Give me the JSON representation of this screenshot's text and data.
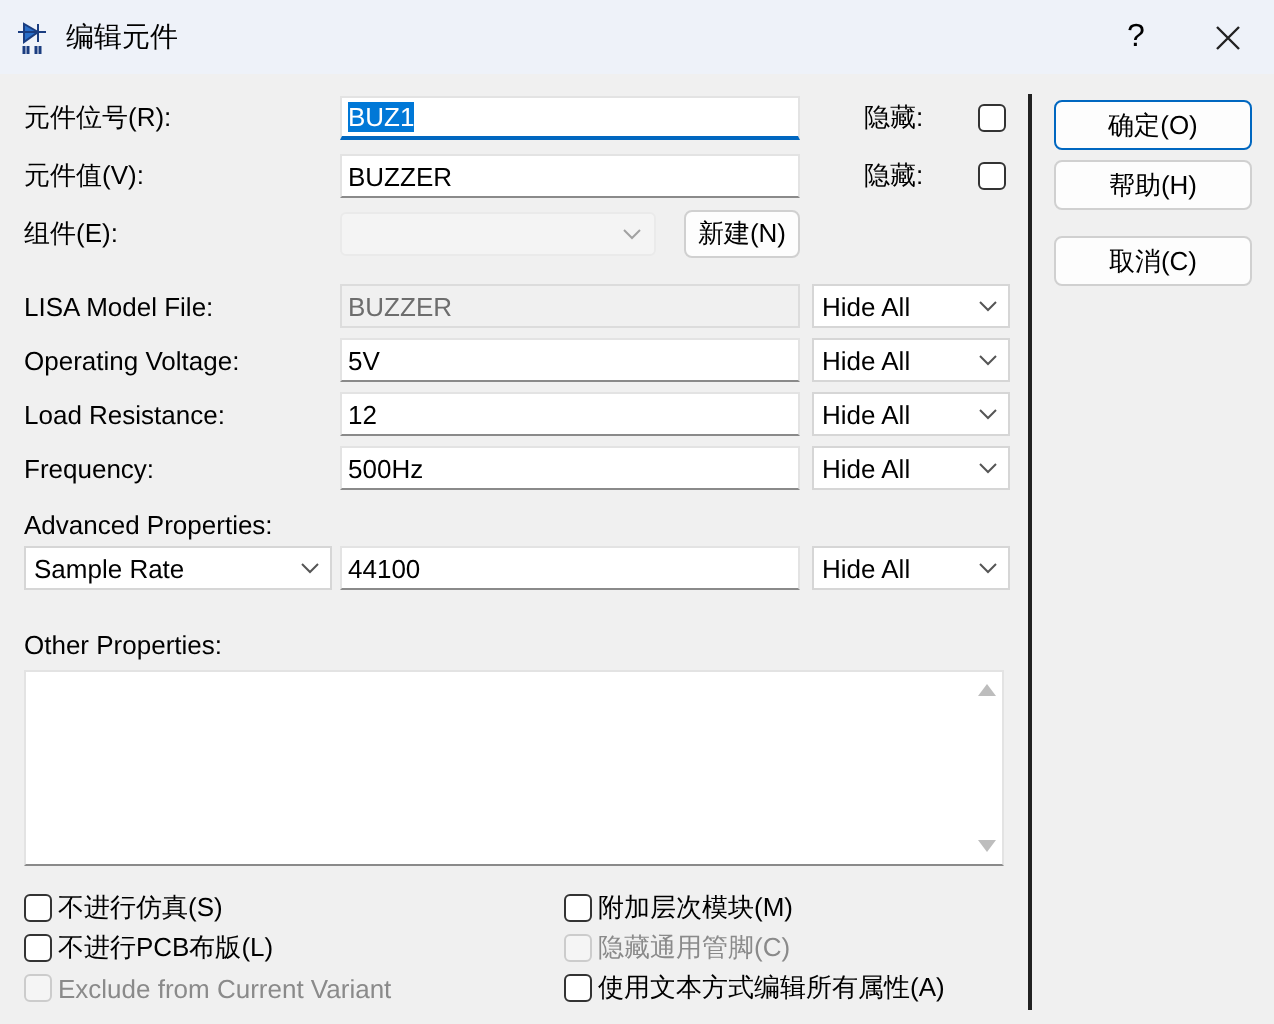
{
  "window": {
    "title": "编辑元件",
    "help": "?"
  },
  "main_fields": [
    {
      "label": "元件位号(R):",
      "value": "BUZ1",
      "selected": true,
      "hide_label": "隐藏:",
      "hidden": false
    },
    {
      "label": "元件值(V):",
      "value": "BUZZER",
      "selected": false,
      "hide_label": "隐藏:",
      "hidden": false
    }
  ],
  "component": {
    "label": "组件(E):",
    "disabled": true,
    "new_button": "新建(N)"
  },
  "properties": [
    {
      "label": "LISA Model File:",
      "value": "BUZZER",
      "disabled": true,
      "visibility": "Hide All"
    },
    {
      "label": "Operating Voltage:",
      "value": "5V",
      "disabled": false,
      "visibility": "Hide All"
    },
    {
      "label": "Load Resistance:",
      "value": "12",
      "disabled": false,
      "visibility": "Hide All"
    },
    {
      "label": "Frequency:",
      "value": "500Hz",
      "disabled": false,
      "visibility": "Hide All"
    }
  ],
  "advanced": {
    "label": "Advanced Properties:",
    "property": "Sample Rate",
    "value": "44100",
    "visibility": "Hide All"
  },
  "other": {
    "label": "Other Properties:"
  },
  "options": [
    {
      "label": "不进行仿真(S)",
      "checked": false,
      "disabled": false
    },
    {
      "label": "附加层次模块(M)",
      "checked": false,
      "disabled": false
    },
    {
      "label": "不进行PCB布版(L)",
      "checked": false,
      "disabled": false
    },
    {
      "label": "隐藏通用管脚(C)",
      "checked": false,
      "disabled": true
    },
    {
      "label": "Exclude from Current Variant",
      "checked": false,
      "disabled": true
    },
    {
      "label": "使用文本方式编辑所有属性(A)",
      "checked": false,
      "disabled": false
    }
  ],
  "buttons": [
    {
      "label": "确定(O)",
      "default": true
    },
    {
      "label": "帮助(H)",
      "default": false
    },
    {
      "label": "取消(C)",
      "default": false
    }
  ]
}
